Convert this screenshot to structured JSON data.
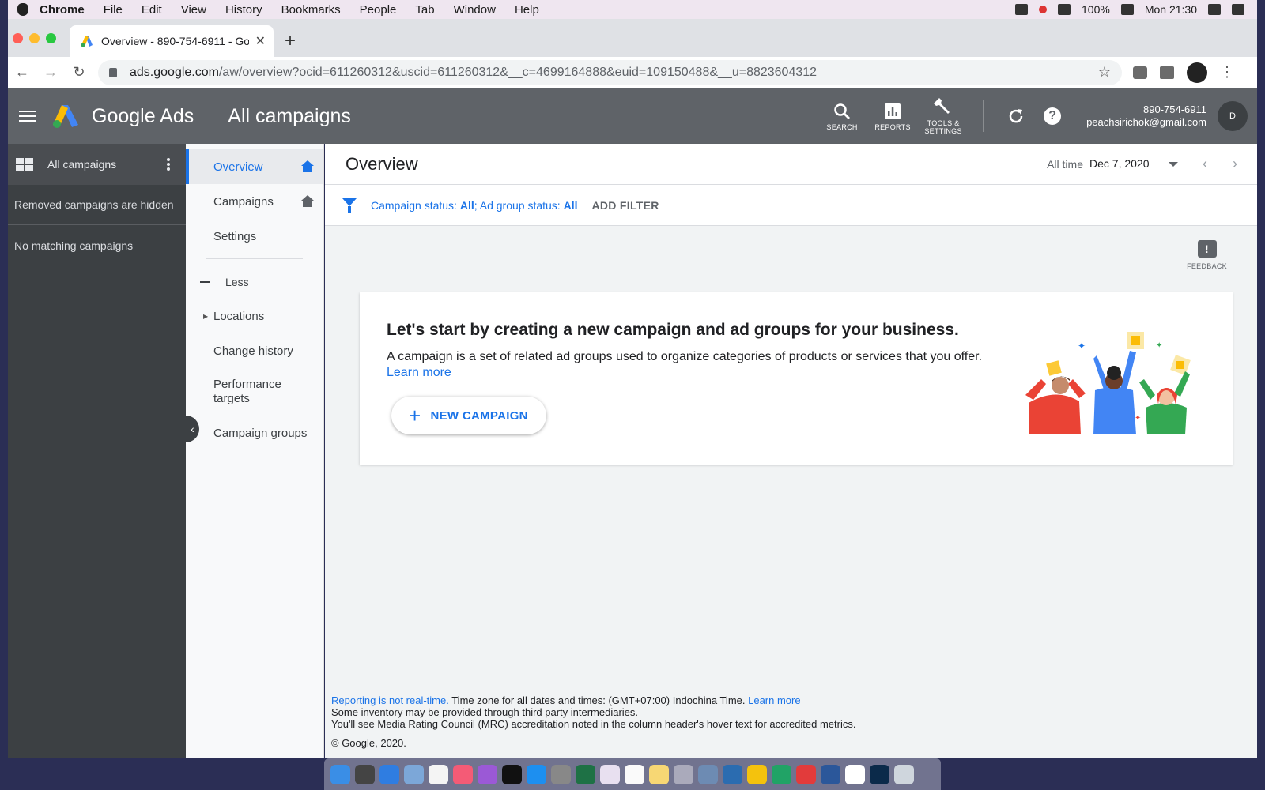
{
  "menubar": {
    "app": "Chrome",
    "items": [
      "File",
      "Edit",
      "View",
      "History",
      "Bookmarks",
      "People",
      "Tab",
      "Window",
      "Help"
    ],
    "battery": "100%",
    "clock": "Mon 21:30"
  },
  "browser": {
    "tab_title": "Overview - 890-754-6911 - Go",
    "url_host": "ads.google.com",
    "url_path": "/aw/overview?ocid=611260312&uscid=611260312&__c=4699164888&euid=109150488&__u=8823604312"
  },
  "header": {
    "brand": "Google Ads",
    "page_title": "All campaigns",
    "tools": [
      {
        "label": "SEARCH",
        "icon": "search-icon"
      },
      {
        "label": "REPORTS",
        "icon": "bar-chart-icon"
      },
      {
        "label": "TOOLS & SETTINGS",
        "icon": "wrench-icon"
      }
    ],
    "account_id": "890-754-6911",
    "account_email": "peachsirichok@gmail.com",
    "avatar_letter": "D"
  },
  "sidebar": {
    "title": "All campaigns",
    "note": "Removed campaigns are hidden",
    "empty": "No matching campaigns"
  },
  "subnav": {
    "overview": "Overview",
    "campaigns": "Campaigns",
    "settings": "Settings",
    "less": "Less",
    "locations": "Locations",
    "change_history": "Change history",
    "performance_targets": "Performance targets",
    "campaign_groups": "Campaign groups"
  },
  "main": {
    "title": "Overview",
    "date_label": "All time",
    "date_value": "Dec 7, 2020",
    "filter_prefix": "Campaign status: ",
    "filter_campaign_value": "All",
    "filter_mid": "; Ad group status: ",
    "filter_adgroup_value": "All",
    "add_filter": "ADD FILTER",
    "feedback": "FEEDBACK"
  },
  "card": {
    "heading": "Let's start by creating a new campaign and ad groups for your business.",
    "body": "A campaign is a set of related ad groups used to organize categories of products or services that you offer.",
    "learn_more": "Learn more",
    "button": "NEW CAMPAIGN"
  },
  "footer": {
    "realtime_link": "Reporting is not real-time.",
    "timezone": " Time zone for all dates and times: (GMT+07:00) Indochina Time. ",
    "learn_more": "Learn more",
    "inventory": "Some inventory may be provided through third party intermediaries.",
    "mrc": "You'll see Media Rating Council (MRC) accreditation noted in the column header's hover text for accredited metrics.",
    "copyright": "© Google, 2020."
  },
  "colors": {
    "accent": "#1a73e8",
    "header_bg": "#5f6368",
    "sidebar_bg": "#3c4043"
  }
}
